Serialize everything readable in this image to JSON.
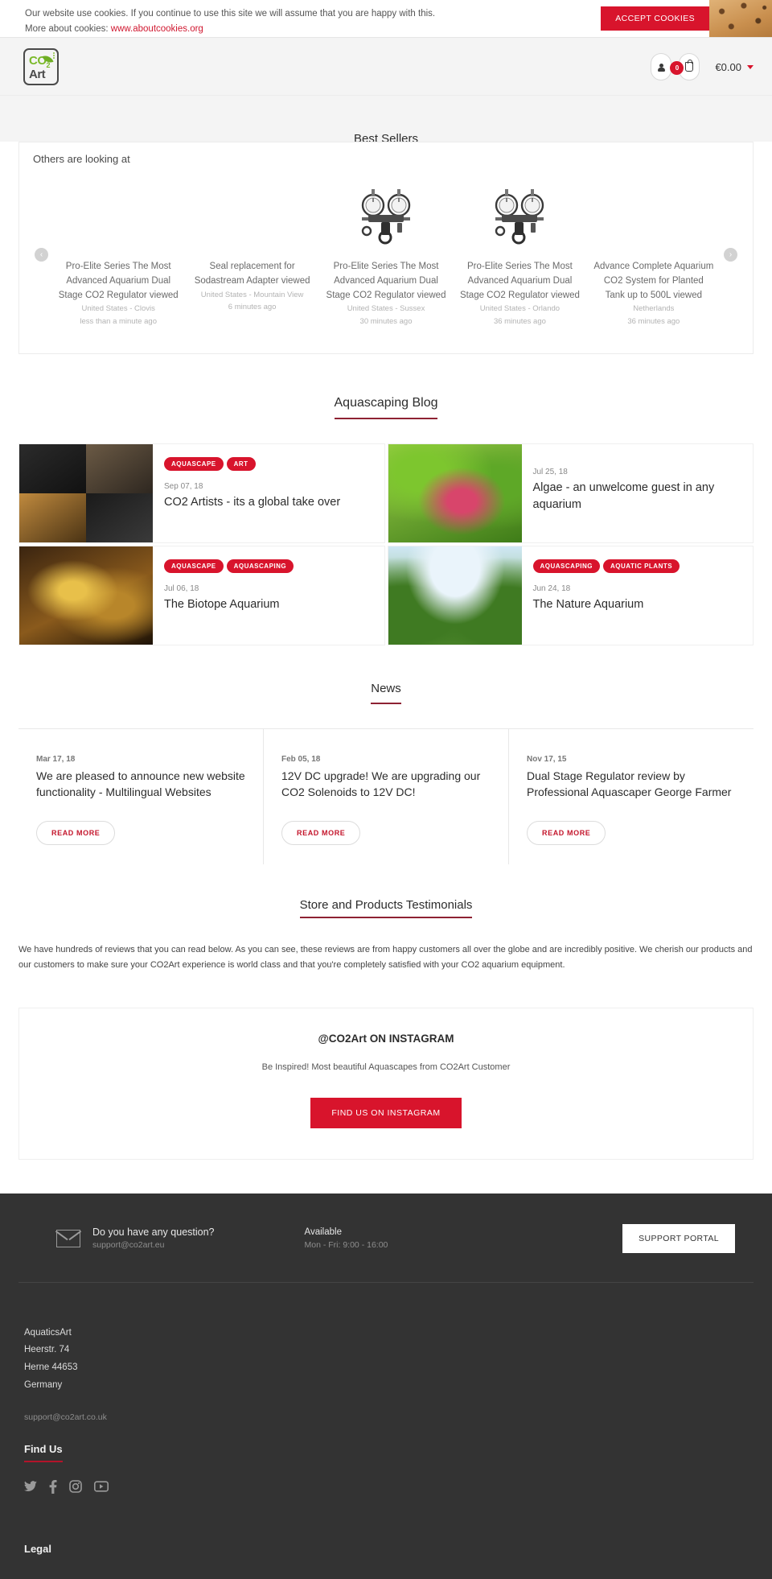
{
  "cookie": {
    "line1": "Our website use cookies. If you continue to use this site we will assume that you are happy with this.",
    "line2_prefix": "More about cookies: ",
    "link": "www.aboutcookies.org",
    "accept_label": "ACCEPT COOKIES"
  },
  "header": {
    "logo_top": "CO",
    "logo_sub": "2",
    "logo_bottom": "Art",
    "cart_count": "0",
    "cart_total": "€0.00"
  },
  "bestsellers": {
    "title": "Best Sellers",
    "prev": "‹",
    "next": "›"
  },
  "others_looking": {
    "title": "Others are looking at",
    "prev": "‹",
    "next": "›",
    "items": [
      {
        "name": "Pro-Elite Series The Most Advanced Aquarium Dual Stage CO2 Regulator viewed",
        "location": "United States - Clovis",
        "time": "less than a minute ago",
        "has_image": false
      },
      {
        "name": "Seal replacement for Sodastream Adapter viewed",
        "location": "United States - Mountain View",
        "time": "6 minutes ago",
        "has_image": false
      },
      {
        "name": "Pro-Elite Series The Most Advanced Aquarium Dual Stage CO2 Regulator viewed",
        "location": "United States - Sussex",
        "time": "30 minutes ago",
        "has_image": true
      },
      {
        "name": "Pro-Elite Series The Most Advanced Aquarium Dual Stage CO2 Regulator viewed",
        "location": "United States - Orlando",
        "time": "36 minutes ago",
        "has_image": true
      },
      {
        "name": "Advance Complete Aquarium CO2 System for Planted Tank up to 500L viewed",
        "location": "Netherlands",
        "time": "36 minutes ago",
        "has_image": false
      }
    ]
  },
  "blog": {
    "heading": "Aquascaping Blog",
    "posts": [
      {
        "tags": [
          "AQUASCAPE",
          "ART"
        ],
        "date": "Sep 07, 18",
        "title": "CO2 Artists - its a global take over",
        "thumb": "collage-people"
      },
      {
        "tags": [],
        "date": "Jul 25, 18",
        "title": "Algae - an unwelcome guest in any aquarium",
        "thumb": "plants-red"
      },
      {
        "tags": [
          "AQUASCAPE",
          "AQUASCAPING"
        ],
        "date": "Jul 06, 18",
        "title": "The Biotope Aquarium",
        "thumb": "biotope-wood"
      },
      {
        "tags": [
          "AQUASCAPING",
          "AQUATIC PLANTS"
        ],
        "date": "Jun 24, 18",
        "title": "The Nature Aquarium",
        "thumb": "nature-valley"
      }
    ]
  },
  "news": {
    "heading": "News",
    "items": [
      {
        "date": "Mar 17, 18",
        "title": "We are pleased to announce new website functionality - Multilingual Websites",
        "button": "READ MORE"
      },
      {
        "date": "Feb 05, 18",
        "title": "12V DC upgrade! We are upgrading our CO2 Solenoids to 12V DC!",
        "button": "READ MORE"
      },
      {
        "date": "Nov 17, 15",
        "title": "Dual Stage Regulator review by Professional Aquascaper George Farmer",
        "button": "READ MORE"
      }
    ]
  },
  "testimonials": {
    "heading": "Store and Products Testimonials",
    "body": "We have hundreds of reviews that you can read below. As you can see, these reviews are from happy customers all over the globe and are incredibly positive. We cherish our products and our customers to make sure your CO2Art experience is world class and that you're completely satisfied with your CO2 aquarium equipment."
  },
  "instagram": {
    "title": "@CO2Art ON INSTAGRAM",
    "subtitle": "Be Inspired! Most beautiful Aquascapes from CO2Art Customer",
    "button": "FIND US ON INSTAGRAM"
  },
  "footer": {
    "question_title": "Do you have any question?",
    "question_email": "support@co2art.eu",
    "available_title": "Available",
    "available_hours": "Mon - Fri: 9:00 - 16:00",
    "support_button": "SUPPORT PORTAL",
    "address": {
      "line1": "AquaticsArt",
      "line2": "Heerstr. 74",
      "line3": "Herne 44653",
      "line4": "Germany"
    },
    "email": "support@co2art.co.uk",
    "find_us": "Find Us",
    "legal": "Legal"
  }
}
